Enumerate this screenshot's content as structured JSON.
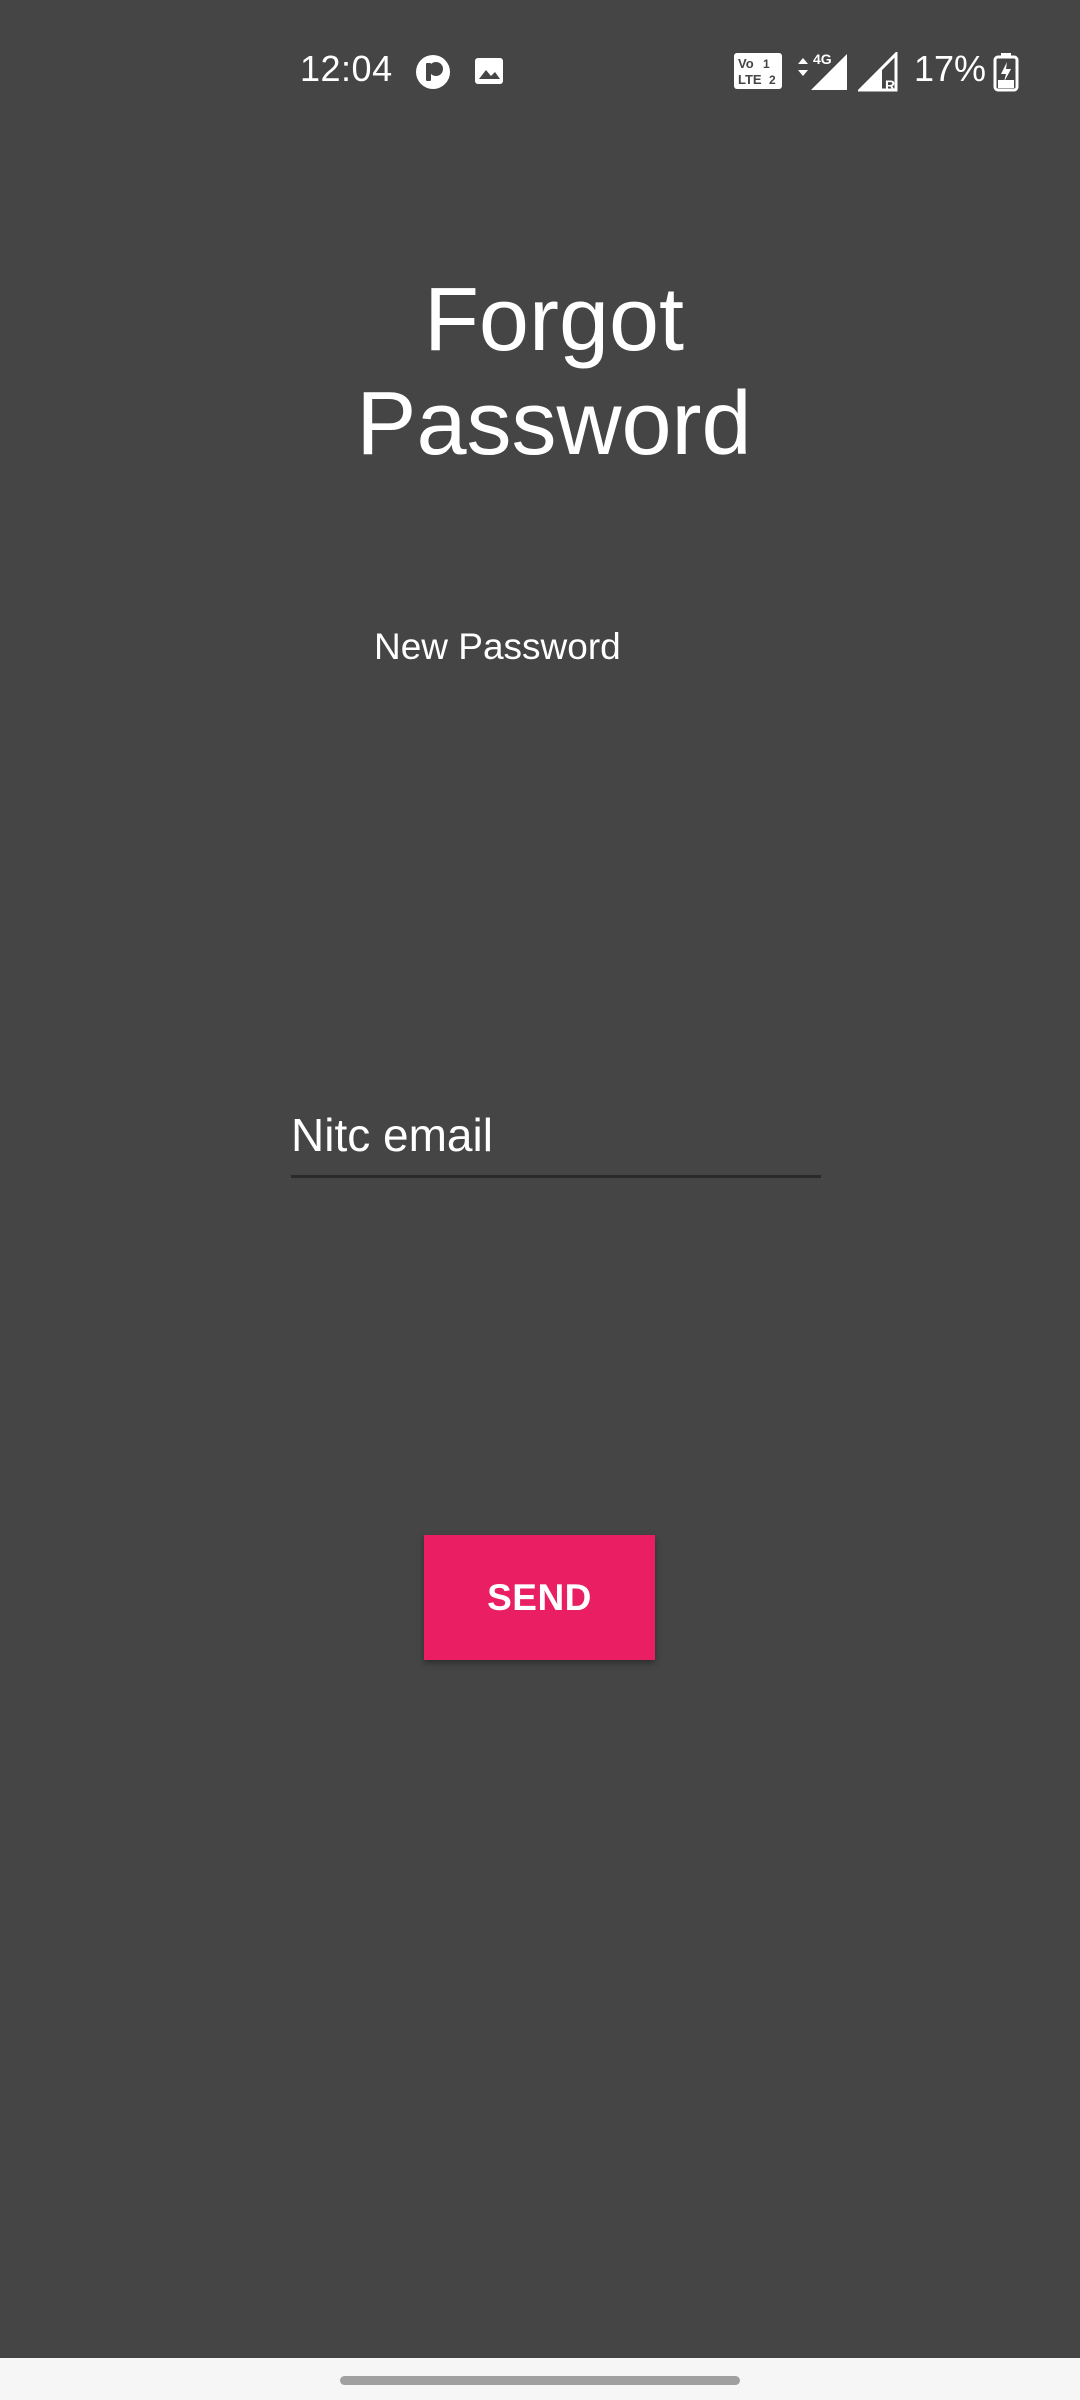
{
  "status_bar": {
    "time": "12:04",
    "battery_percent": "17%",
    "icons": [
      "app-notification-icon",
      "gallery-icon",
      "volte-icon",
      "signal-4g-icon",
      "signal-roaming-icon",
      "battery-charging-icon"
    ]
  },
  "page": {
    "title_line1": "Forgot",
    "title_line2": "Password",
    "subtitle": "New Password"
  },
  "form": {
    "email_placeholder": "Nitc email",
    "email_value": "",
    "send_label": "SEND"
  },
  "colors": {
    "background": "#454545",
    "accent": "#e91e63",
    "text": "#ffffff",
    "nav_bar": "#f6f6f6"
  }
}
